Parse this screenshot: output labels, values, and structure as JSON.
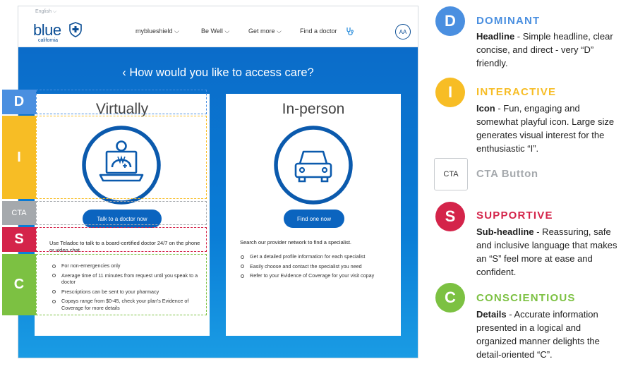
{
  "site": {
    "language": "English ⌵",
    "logo_word": "blue",
    "logo_sub": "california",
    "nav": [
      "myblueshield ⌵",
      "Be Well ⌵",
      "Get more ⌵",
      "Find a doctor"
    ],
    "accessibility_label": "AA",
    "hero_title": "‹ How would you like to access care?"
  },
  "cards": {
    "virtual": {
      "title": "Virtually",
      "cta": "Talk to a doctor now",
      "subhead": "Use Teladoc to talk to a board-certified doctor 24/7 on the phone or video chat.",
      "bullets": [
        "For non-emergencies only",
        "Average time of 11 minutes from request until you speak to a doctor",
        "Prescriptions can be sent to your pharmacy",
        "Copays range from $0-45, check your plan's Evidence of Coverage for more details"
      ]
    },
    "inperson": {
      "title": "In-person",
      "cta": "Find one now",
      "subhead": "Search our provider network to find a specialist.",
      "bullets": [
        "Get a detailed profile information for each specialist",
        "Easily choose and contact the specialist you need",
        "Refer to your Evidence of Coverage for your visit copay"
      ]
    }
  },
  "disc_tags": {
    "d": "D",
    "i": "I",
    "cta": "CTA",
    "s": "S",
    "c": "C"
  },
  "legend": {
    "d": {
      "letter": "D",
      "title": "DOMINANT",
      "term": "Headline",
      "desc": " - Simple headline, clear concise, and direct - very “D” friendly."
    },
    "i": {
      "letter": "I",
      "title": "INTERACTIVE",
      "term": "Icon",
      "desc": " - Fun, engaging and somewhat playful icon. Large size generates visual interest for the enthusiastic “I”."
    },
    "cta": {
      "label": "CTA",
      "title": "CTA Button"
    },
    "s": {
      "letter": "S",
      "title": "SUPPORTIVE",
      "term": "Sub-headline",
      "desc": " - Reassuring, safe and inclusive language that makes an “S” feel more at ease and confident."
    },
    "c": {
      "letter": "C",
      "title": "CONSCIENTIOUS",
      "term": "Details",
      "desc": " - Accurate information presented in a logical and organized manner delights the detail-oriented “C”."
    }
  },
  "colors": {
    "d": "#4a8fe0",
    "i": "#f7bd25",
    "cta": "#a5a9ad",
    "s": "#d4244a",
    "c": "#7cc142",
    "brand_blue": "#0b64bf"
  },
  "icons": {
    "logo": "shield-cross-icon",
    "find_doctor": "stethoscope-icon",
    "virtual": "laptop-doctor-icon",
    "inperson": "car-icon"
  }
}
